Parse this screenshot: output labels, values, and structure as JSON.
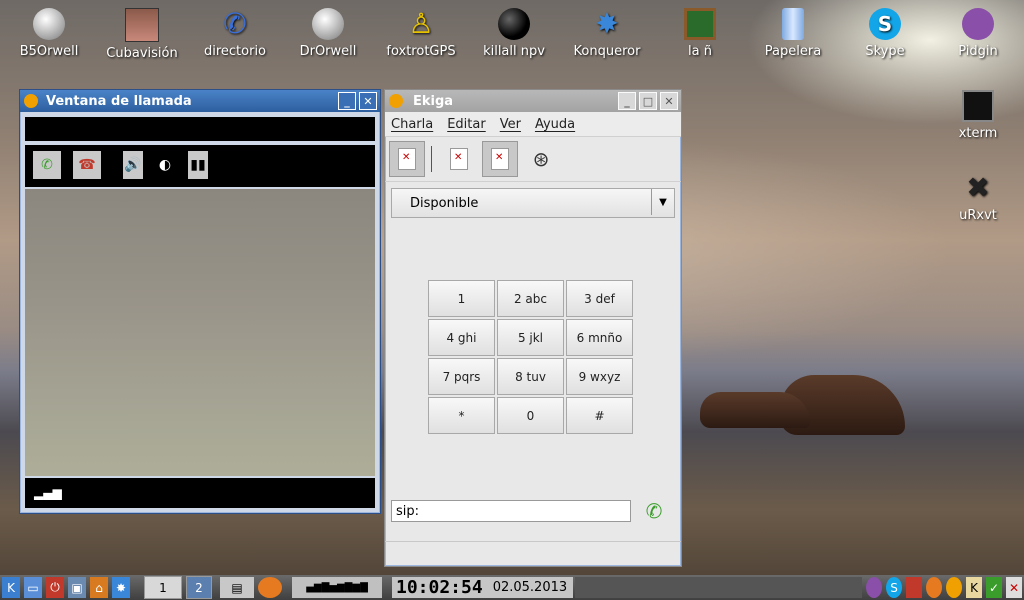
{
  "desktop": {
    "icons": [
      {
        "label": "B5Orwell"
      },
      {
        "label": "Cubavisión"
      },
      {
        "label": "directorio"
      },
      {
        "label": "DrOrwell"
      },
      {
        "label": "foxtrotGPS"
      },
      {
        "label": "killall npv"
      },
      {
        "label": "Konqueror"
      },
      {
        "label": "la ñ"
      },
      {
        "label": "Papelera"
      },
      {
        "label": "Skype"
      },
      {
        "label": "Pidgin"
      },
      {
        "label": "xterm"
      },
      {
        "label": "uRxvt"
      }
    ]
  },
  "call_window": {
    "title": "Ventana de llamada",
    "controls": [
      "pickup-icon",
      "hangup-icon",
      "speaker-icon",
      "video-icon",
      "pause-icon"
    ]
  },
  "ekiga": {
    "title": "Ekiga",
    "menu": [
      "Charla",
      "Editar",
      "Ver",
      "Ayuda"
    ],
    "status": "Disponible",
    "keypad": [
      "1",
      "2 abc",
      "3 def",
      "4 ghi",
      "5 jkl",
      "6 mnño",
      "7 pqrs",
      "8 tuv",
      "9 wxyz",
      "*",
      "0",
      "#"
    ],
    "address_value": "sip:"
  },
  "taskbar": {
    "desktop1": "1",
    "desktop2": "2",
    "clock": "10:02:54",
    "date": "02.05.2013"
  },
  "colors": {
    "kde_titlebar": "#2d5f9f",
    "ekiga_titlebar": "#a3a3a3",
    "call_green": "#3a9d2b",
    "hangup_red": "#c0392b"
  }
}
